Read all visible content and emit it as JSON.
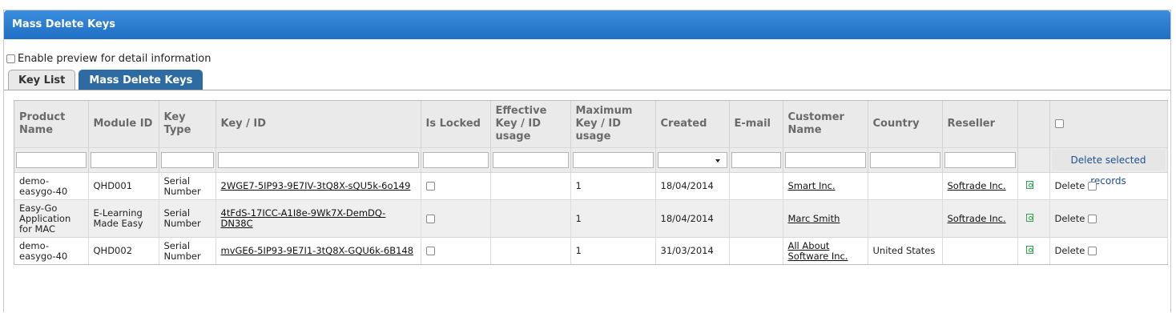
{
  "panel": {
    "title": "Mass Delete Keys"
  },
  "preview": {
    "label": "Enable preview for detail information"
  },
  "tabs": [
    {
      "label": "Key List"
    },
    {
      "label": "Mass Delete Keys"
    }
  ],
  "columns": [
    {
      "label": "Product Name"
    },
    {
      "label": "Module ID"
    },
    {
      "label": "Key Type"
    },
    {
      "label": "Key / ID"
    },
    {
      "label": "Is Locked"
    },
    {
      "label": "Effective Key / ID usage"
    },
    {
      "label": "Maximum Key / ID usage"
    },
    {
      "label": "Created"
    },
    {
      "label": "E-mail"
    },
    {
      "label": "Customer Name"
    },
    {
      "label": "Country"
    },
    {
      "label": "Reseller"
    },
    {
      "label": ""
    }
  ],
  "actions": {
    "delete_selected": "Delete selected records"
  },
  "rows": [
    {
      "product": "demo-easygo-40",
      "module": "QHD001",
      "key_type": "Serial Number",
      "key": "2WGE7-5IP93-9E7IV-3tQ8X-sQU5k-6o149",
      "max_usage": "1",
      "created": "18/04/2014",
      "email": "",
      "customer": "Smart Inc.",
      "country": "",
      "reseller": "Softrade Inc.",
      "delete_label": "Delete"
    },
    {
      "product": "Easy-Go Application for MAC",
      "module": "E-Learning Made Easy",
      "key_type": "Serial Number",
      "key": "4tFdS-17ICC-A1I8e-9Wk7X-DemDQ-DN38C",
      "max_usage": "1",
      "created": "18/04/2014",
      "email": "",
      "customer": "Marc Smith",
      "country": "",
      "reseller": "Softrade Inc.",
      "delete_label": "Delete"
    },
    {
      "product": "demo-easygo-40",
      "module": "QHD002",
      "key_type": "Serial Number",
      "key": "mvGE6-5IP93-9E7I1-3tQ8X-GQU6k-6B148",
      "max_usage": "1",
      "created": "31/03/2014",
      "email": "",
      "customer": "All About Software Inc.",
      "country": "United States",
      "reseller": "",
      "delete_label": "Delete"
    }
  ]
}
